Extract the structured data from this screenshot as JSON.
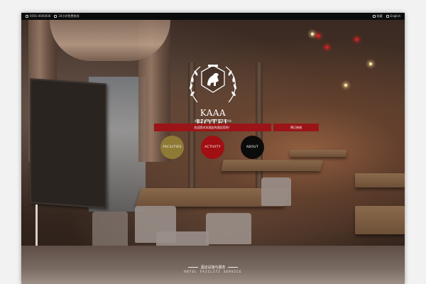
{
  "topbar": {
    "phone": "0591-0000000",
    "hotline": "24小时免费热线",
    "bookmark": "收藏",
    "language": "English"
  },
  "logo": {
    "brand": "KAAA HOTEL",
    "slogan": "顾客 COMPANY SLOGAN"
  },
  "hero": {
    "welcome_text": "欢迎您对本酒店的酒店官网！",
    "contact_label": "预订热线"
  },
  "circles": [
    {
      "label": "FACILITIES",
      "color": "#8e7a35"
    },
    {
      "label": "ACTIVITY",
      "color": "#a10f13"
    },
    {
      "label": "ABOUT",
      "color": "#0b0b0b"
    }
  ],
  "services": {
    "title": "酒店设施与服务",
    "subtitle": "HOTEL FAICLITI SERVICE"
  }
}
